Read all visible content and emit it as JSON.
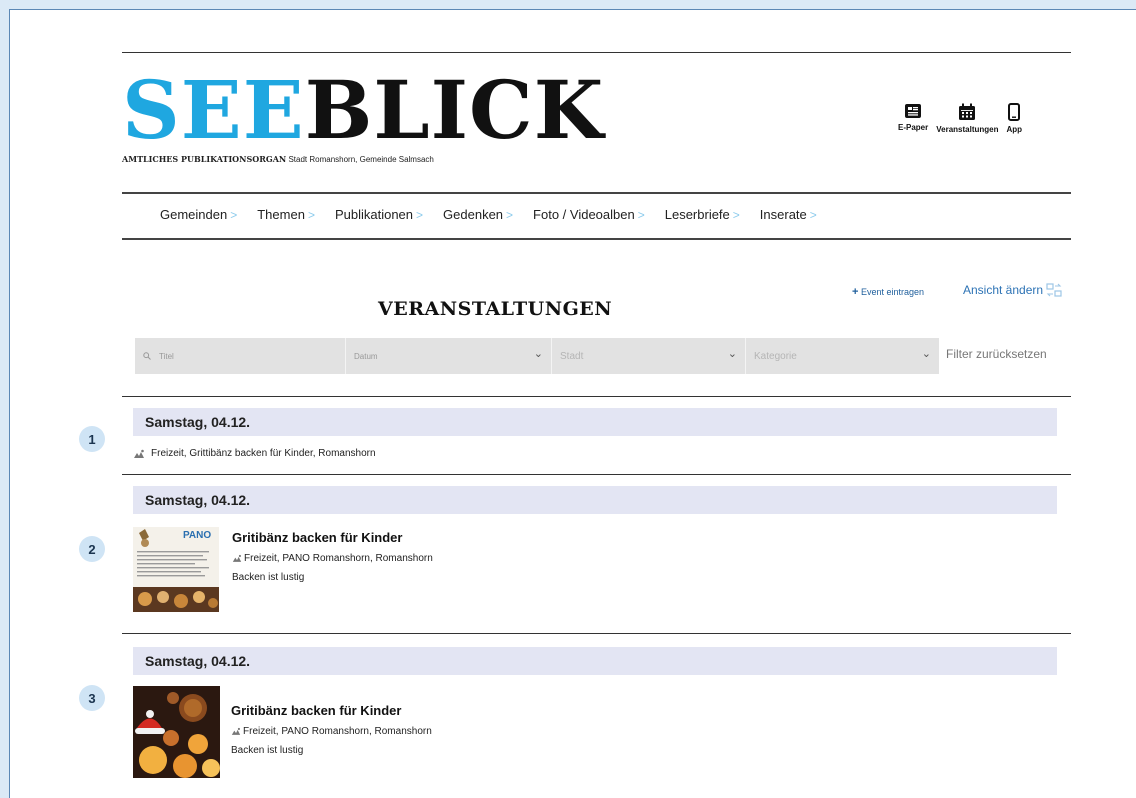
{
  "header": {
    "logo_part1": "SEE",
    "logo_part2": "BLICK",
    "subline_strong": "AMTLICHES PUBLIKATIONSORGAN",
    "subline_rest": "Stadt Romanshorn, Gemeinde Salmsach",
    "icons": [
      {
        "label": "E-Paper",
        "icon": "newspaper-icon"
      },
      {
        "label": "Veranstaltungen",
        "icon": "calendar-icon"
      },
      {
        "label": "App",
        "icon": "smartphone-icon"
      }
    ]
  },
  "nav": {
    "items": [
      "Gemeinden",
      "Themen",
      "Publikationen",
      "Gedenken",
      "Foto / Videoalben",
      "Leserbriefe",
      "Inserate"
    ]
  },
  "section": {
    "title": "VERANSTALTUNGEN",
    "add_event": "Event eintragen",
    "view_toggle": "Ansicht ändern"
  },
  "filters": {
    "title_placeholder": "Titel",
    "date_placeholder": "Datum",
    "city_placeholder": "Stadt",
    "category_placeholder": "Kategorie",
    "reset": "Filter zurücksetzen"
  },
  "events": [
    {
      "badge": "1",
      "date": "Samstag, 04.12.",
      "line": "Freizeit, Grittibänz backen für Kinder, Romanshorn"
    },
    {
      "badge": "2",
      "date": "Samstag, 04.12.",
      "title": "Gritibänz backen für Kinder",
      "meta": "Freizeit, PANO Romanshorn, Romanshorn",
      "desc": "Backen ist lustig",
      "thumb_text": "PANO"
    },
    {
      "badge": "3",
      "date": "Samstag, 04.12.",
      "title": "Gritibänz backen für Kinder",
      "meta": "Freizeit, PANO Romanshorn, Romanshorn",
      "desc": "Backen ist lustig"
    }
  ],
  "colors": {
    "brand_blue": "#1fa7e0",
    "date_bar": "#e3e5f3",
    "badge": "#cfe4f5",
    "link": "#2d73b5"
  }
}
